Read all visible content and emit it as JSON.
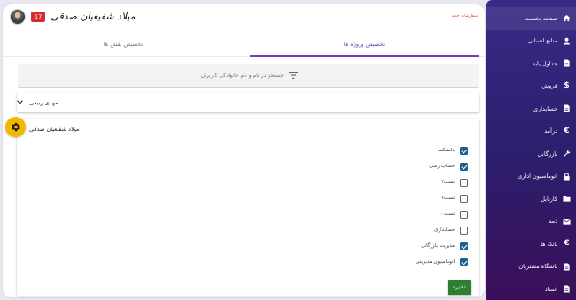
{
  "header": {
    "user_name": "میلاد شفیعیان صدقی",
    "notification_count": "17",
    "red_note": "ﺳﻔﺎﺭﺷﺎﺕ ﺟﺪﻳﺪ"
  },
  "tabs": [
    {
      "label": "تخصیص پروژه ها",
      "active": true
    },
    {
      "label": "تخصیص نقش ها",
      "active": false
    }
  ],
  "search": {
    "placeholder": "جستجو در نام و نام خانوادگی کاربران"
  },
  "panels": [
    {
      "title": "مهدی ربیعی",
      "expanded": false
    },
    {
      "title": "میلاد شفیعیان صدقی",
      "expanded": true
    }
  ],
  "permissions": [
    {
      "label": "دانشکده",
      "checked": true
    },
    {
      "label": "حساب رسی",
      "checked": true
    },
    {
      "label": "تست۳",
      "checked": false
    },
    {
      "label": "تست۶",
      "checked": false
    },
    {
      "label": "تست۱۰",
      "checked": false
    },
    {
      "label": "حسابداری",
      "checked": false
    },
    {
      "label": "مدیریت بازرگانی",
      "checked": true
    },
    {
      "label": "اتوماسیون مدیریتی",
      "checked": true
    }
  ],
  "save_label": "ذخیره",
  "sidebar": {
    "items": [
      {
        "label": "صفحه نخست",
        "icon": "home-icon"
      },
      {
        "label": "منابع انسانی",
        "icon": "person-icon"
      },
      {
        "label": "جداول پایه",
        "icon": "document-icon"
      },
      {
        "label": "فروش",
        "icon": "dollar-icon"
      },
      {
        "label": "حسابداری",
        "icon": "document-icon"
      },
      {
        "label": "درآمد",
        "icon": "euro-icon"
      },
      {
        "label": "بازرگانی",
        "icon": "wrench-icon"
      },
      {
        "label": "اتوماسیون اداری",
        "icon": "lock-icon"
      },
      {
        "label": "کارتابل",
        "icon": "folder-icon"
      },
      {
        "label": "ذمه",
        "icon": "mail-icon"
      },
      {
        "label": "بانک ها",
        "icon": "euro-icon"
      },
      {
        "label": "باشگاه مشتریان",
        "icon": "document-icon"
      },
      {
        "label": "اسناد",
        "icon": "document-icon"
      }
    ]
  },
  "colors": {
    "accent": "#6a3fb8",
    "checkbox": "#1f5f8b",
    "save": "#2e7d32",
    "sidebar_top": "#3a2a86",
    "sidebar_bottom": "#3b0f5a",
    "gear": "#f5b800"
  }
}
